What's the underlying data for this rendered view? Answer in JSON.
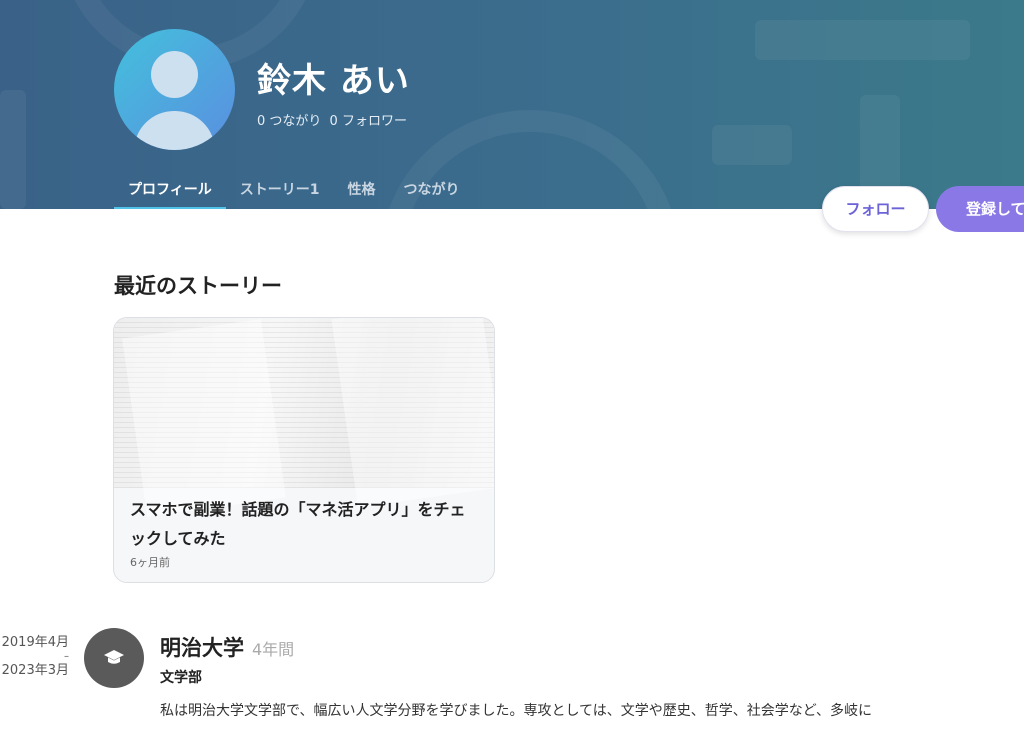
{
  "profile": {
    "name": "鈴木 あい",
    "connections": "0 つながり",
    "followers": "0 フォロワー"
  },
  "tabs": [
    {
      "label": "プロフィール",
      "active": true
    },
    {
      "label": "ストーリー1",
      "active": false
    },
    {
      "label": "性格",
      "active": false
    },
    {
      "label": "つながり",
      "active": false
    }
  ],
  "actions": {
    "follow_label": "フォロー",
    "register_label": "登録して"
  },
  "recent_stories": {
    "title": "最近のストーリー",
    "items": [
      {
        "title": "スマホで副業！話題の「マネ活アプリ」をチェックしてみた",
        "date": "6ヶ月前"
      }
    ]
  },
  "education": {
    "start": "2019年4月",
    "separator": "–",
    "end": "2023年3月",
    "school": "明治大学",
    "duration": "4年間",
    "department": "文学部",
    "description": "私は明治大学文学部で、幅広い人文学分野を学びました。専攻としては、文学や歴史、哲学、社会学など、多岐に"
  },
  "colors": {
    "banner": "#3b6d8d",
    "tab_underline": "#4fc3e8",
    "accent": "#8a78e6",
    "follow_text": "#6c63d9"
  },
  "icons": {
    "avatar": "user-silhouette",
    "education": "graduation-cap-icon"
  }
}
